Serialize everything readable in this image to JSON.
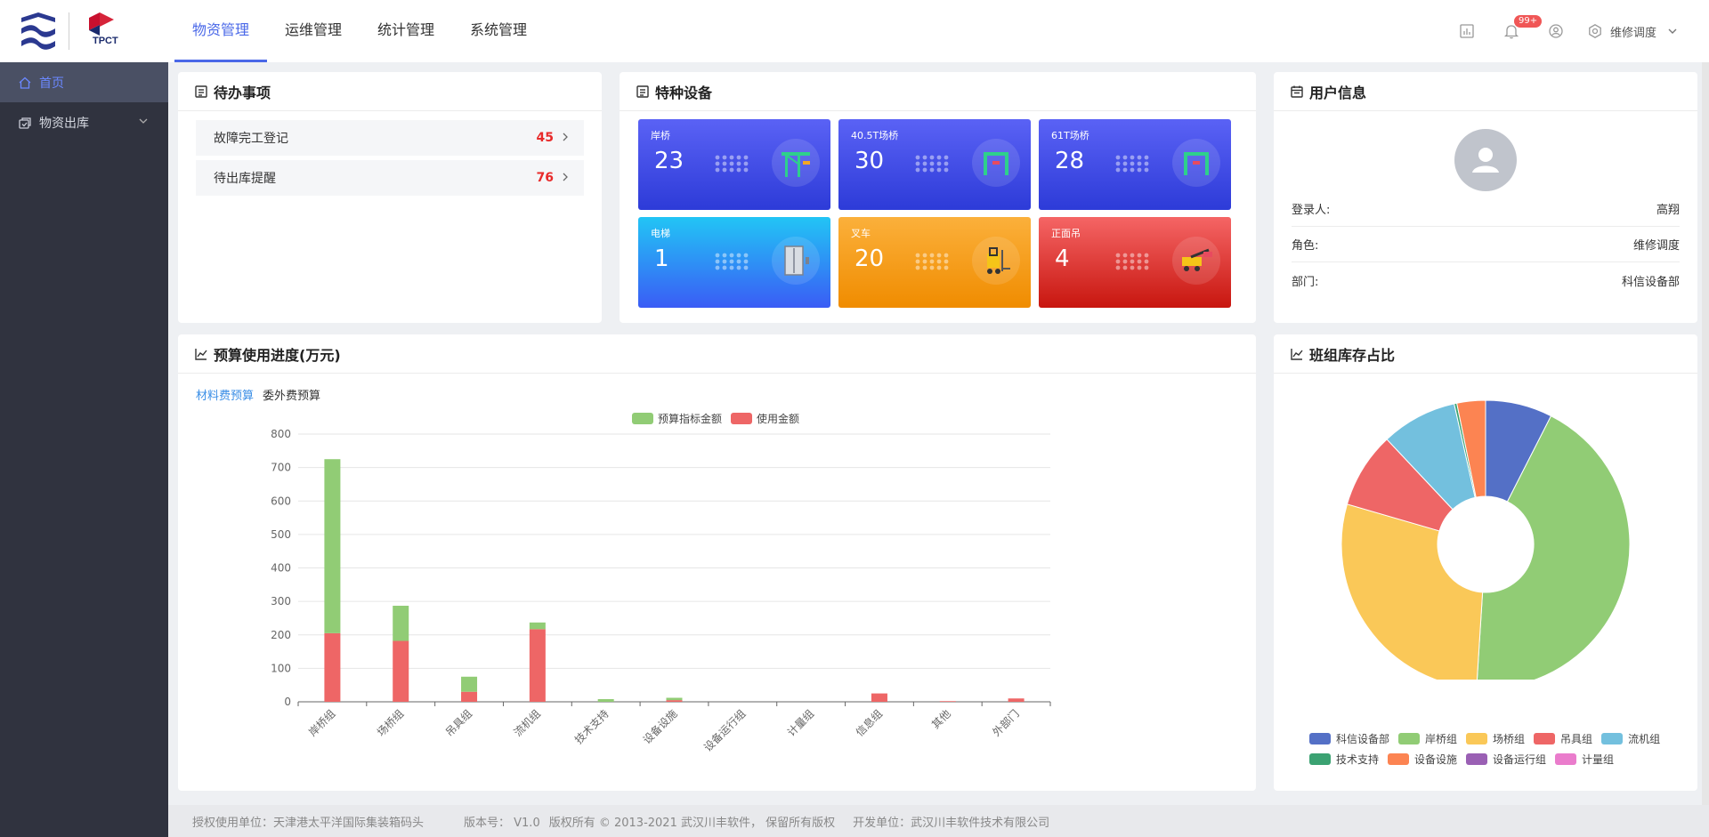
{
  "brand": {
    "logo_text": "TPCT"
  },
  "nav": {
    "items": [
      {
        "label": "物资管理",
        "active": true
      },
      {
        "label": "运维管理",
        "active": false
      },
      {
        "label": "统计管理",
        "active": false
      },
      {
        "label": "系统管理",
        "active": false
      }
    ]
  },
  "header_tools": {
    "notification_badge": "99+",
    "user_role": "维修调度",
    "icons": [
      "chart-icon",
      "bell-icon",
      "user-circle-icon",
      "settings-icon",
      "chevron-down-icon"
    ]
  },
  "sidebar": {
    "items": [
      {
        "label": "首页",
        "icon": "home-icon",
        "active": true
      },
      {
        "label": "物资出库",
        "icon": "outbound-icon",
        "active": false,
        "expandable": true
      }
    ]
  },
  "todo": {
    "title": "待办事项",
    "items": [
      {
        "label": "故障完工登记",
        "count": "45"
      },
      {
        "label": "待出库提醒",
        "count": "76"
      }
    ]
  },
  "special_equipment": {
    "title": "特种设备",
    "tiles": [
      {
        "name": "岸桥",
        "value": "23",
        "color_top": "#5a62f5",
        "color_bottom": "#2d3bd8",
        "icon": "quay-crane-icon"
      },
      {
        "name": "40.5T场桥",
        "value": "30",
        "color_top": "#5a62f5",
        "color_bottom": "#2d3bd8",
        "icon": "gantry-crane-icon"
      },
      {
        "name": "61T场桥",
        "value": "28",
        "color_top": "#5a62f5",
        "color_bottom": "#2d3bd8",
        "icon": "gantry-crane-icon"
      },
      {
        "name": "电梯",
        "value": "1",
        "color_top": "#22c5f5",
        "color_bottom": "#3a5cf5",
        "icon": "elevator-icon"
      },
      {
        "name": "叉车",
        "value": "20",
        "color_top": "#fbb03b",
        "color_bottom": "#f08c00",
        "icon": "forklift-icon"
      },
      {
        "name": "正面吊",
        "value": "4",
        "color_top": "#f56565",
        "color_bottom": "#c8160f",
        "icon": "reach-stacker-icon"
      }
    ]
  },
  "user_info": {
    "title": "用户信息",
    "rows": [
      {
        "label": "登录人:",
        "value": "高翔"
      },
      {
        "label": "角色:",
        "value": "维修调度"
      },
      {
        "label": "部门:",
        "value": "科信设备部"
      }
    ]
  },
  "budget": {
    "title": "预算使用进度(万元)",
    "tabs": [
      {
        "label": "材料费预算",
        "active": true
      },
      {
        "label": "委外费预算",
        "active": false
      }
    ]
  },
  "inventory": {
    "title": "班组库存占比"
  },
  "chart_data": [
    {
      "type": "bar",
      "stacked": true,
      "categories": [
        "岸桥组",
        "场桥组",
        "吊具组",
        "流机组",
        "技术支持",
        "设备设施",
        "设备运行组",
        "计量组",
        "信息组",
        "其他",
        "外部门"
      ],
      "series": [
        {
          "name": "使用金额",
          "color": "#ee6666",
          "values": [
            205,
            182,
            30,
            217,
            0,
            5,
            0,
            0,
            25,
            2,
            10
          ]
        },
        {
          "name": "预算指标金额",
          "color": "#91cc75",
          "values": [
            520,
            105,
            45,
            20,
            8,
            7,
            0,
            0,
            0,
            0,
            0
          ]
        }
      ],
      "ylim": [
        0,
        800
      ],
      "yticks": [
        0,
        100,
        200,
        300,
        400,
        500,
        600,
        700,
        800
      ],
      "legend": [
        "预算指标金额",
        "使用金额"
      ],
      "legend_position": "top-center",
      "grid": true
    },
    {
      "type": "pie",
      "donut": true,
      "slices": [
        {
          "name": "科信设备部",
          "value": 7.5,
          "color": "#5470c6"
        },
        {
          "name": "岸桥组",
          "value": 43.5,
          "color": "#91cc75"
        },
        {
          "name": "场桥组",
          "value": 28.5,
          "color": "#fac858"
        },
        {
          "name": "吊具组",
          "value": 8.5,
          "color": "#ee6666"
        },
        {
          "name": "流机组",
          "value": 8.5,
          "color": "#73c0de"
        },
        {
          "name": "技术支持",
          "value": 0.3,
          "color": "#3ba272"
        },
        {
          "name": "设备设施",
          "value": 3.2,
          "color": "#fc8452"
        },
        {
          "name": "设备运行组",
          "value": 0,
          "color": "#9a60b4"
        },
        {
          "name": "计量组",
          "value": 0,
          "color": "#ea7ccc"
        }
      ],
      "legend_position": "bottom"
    }
  ],
  "footer": {
    "license": "授权使用单位：天津港太平洋国际集装箱码头",
    "version": "版本号：  V1.0",
    "copyright": "版权所有 © 2013-2021 武汉川丰软件，  保留所有版权",
    "developer": "开发单位：武汉川丰软件技术有限公司"
  }
}
